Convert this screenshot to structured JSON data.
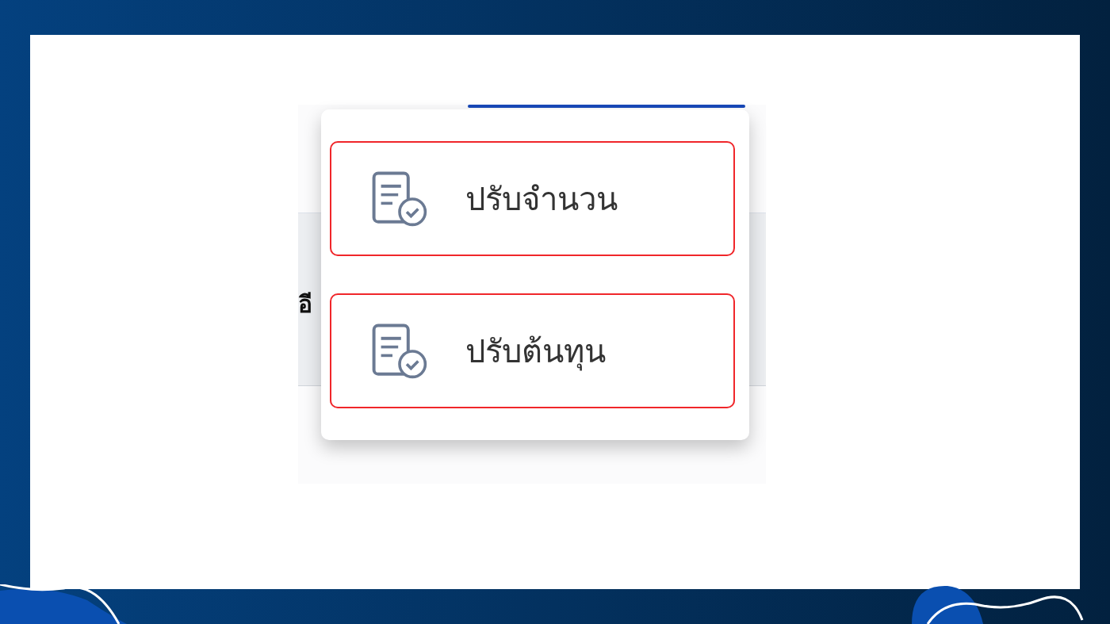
{
  "background_page": {
    "cut_text": "อี"
  },
  "menu": {
    "items": [
      {
        "label": "ปรับจำนวน",
        "highlighted": true
      },
      {
        "label": "ปรับต้นทุน",
        "highlighted": true
      }
    ]
  }
}
